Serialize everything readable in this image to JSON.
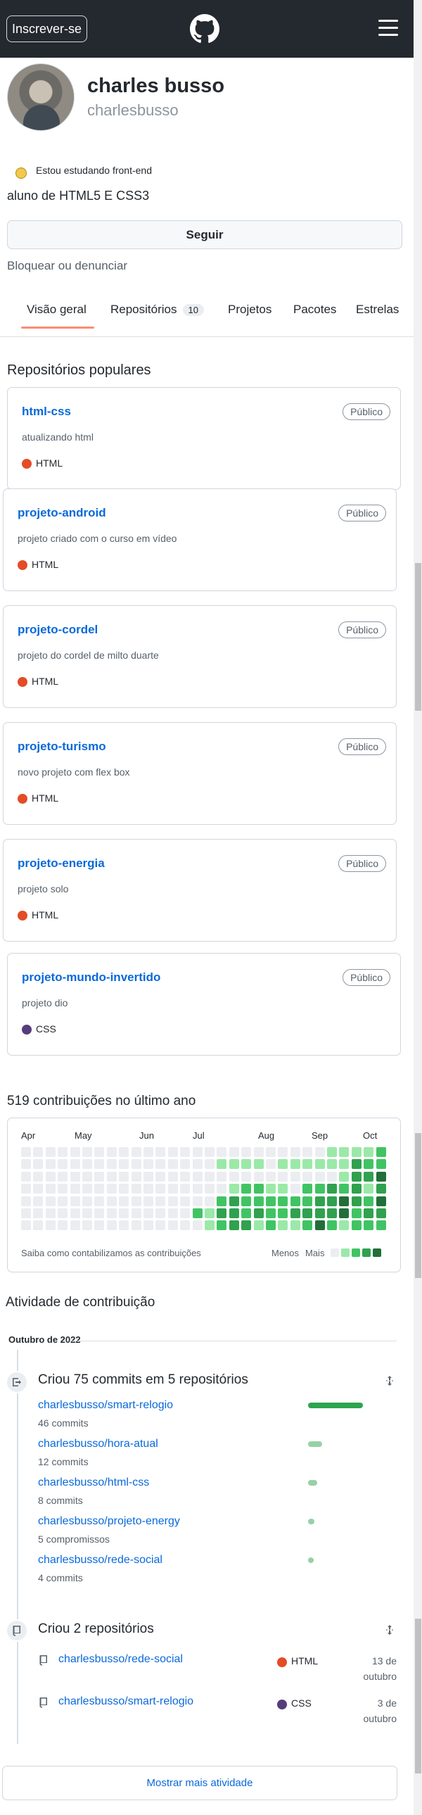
{
  "header": {
    "signup_label": "Inscrever-se",
    "logo_icon": "github-logo-icon",
    "menu_icon": "hamburger-icon"
  },
  "profile": {
    "name": "charles busso",
    "login": "charlesbusso",
    "status_emoji": "emoji-icon",
    "status_text": "Estou estudando front-end",
    "bio": "aluno de HTML5 E CSS3",
    "follow_label": "Seguir",
    "block_label": "Bloquear ou denunciar"
  },
  "tabs": [
    {
      "label": "Visão geral"
    },
    {
      "label": "Repositórios",
      "count": "10"
    },
    {
      "label": "Projetos"
    },
    {
      "label": "Pacotes"
    },
    {
      "label": "Estrelas"
    }
  ],
  "popular": {
    "title": "Repositórios populares",
    "repos": [
      {
        "name": "html-css",
        "visibility": "Público",
        "description": "atualizando html",
        "language": "HTML",
        "color": "#e34c26"
      },
      {
        "name": "projeto-android",
        "visibility": "Público",
        "description": "projeto criado com o curso em vídeo",
        "language": "HTML",
        "color": "#e34c26"
      },
      {
        "name": "projeto-cordel",
        "visibility": "Público",
        "description": "projeto do cordel de milto duarte",
        "language": "HTML",
        "color": "#e34c26"
      },
      {
        "name": "projeto-turismo",
        "visibility": "Público",
        "description": "novo projeto com flex box",
        "language": "HTML",
        "color": "#e34c26"
      },
      {
        "name": "projeto-energia",
        "visibility": "Público",
        "description": "projeto solo",
        "language": "HTML",
        "color": "#e34c26"
      },
      {
        "name": "projeto-mundo-invertido",
        "visibility": "Público",
        "description": "projeto dio",
        "language": "CSS",
        "color": "#563d7c"
      }
    ]
  },
  "contributions": {
    "title": "519 contribuições no último ano",
    "months": [
      "Apr",
      "May",
      "Jun",
      "Jul",
      "Aug",
      "Sep",
      "Oct"
    ],
    "levels": [
      "0000000000000000",
      "0000000000000000",
      "0000000000000000",
      "0000000000000000",
      "0000000000000000",
      "0000000000000000",
      "0000000000000000",
      "0000000000000000",
      "0000000000000000",
      "0000000000000000",
      "0000000000000000",
      "0000000000000000",
      "0000000000000000",
      "0000000000000000",
      "0000020000000000",
      "0000011200000000",
      "0100232000000000",
      "0101333000000000",
      "0102223000000000",
      "0102231000000000",
      "0001222000000000",
      "0101221000000000",
      "0100231000000000",
      "0102232000000000",
      "0102334000000000",
      "1103332000000000",
      "1112441200000000",
      "1333322000000000",
      "1231232000000000",
      "2243432000000000"
    ],
    "colors": [
      "#ebedf0",
      "#9be9a8",
      "#40c463",
      "#30a14e",
      "#216e39"
    ],
    "legend_note": "Saiba como contabilizamos as contribuições",
    "legend_less": "Menos",
    "legend_more": "Mais"
  },
  "activity": {
    "title": "Atividade de contribuição",
    "period": "Outubro de 2022",
    "commits": {
      "title": "Criou 75 commits em 5 repositórios",
      "items": [
        {
          "repo": "charlesbusso/smart-relogio",
          "count": "46 commits",
          "share": 1.0
        },
        {
          "repo": "charlesbusso/hora-atual",
          "count": "12 commits",
          "share": 0.26
        },
        {
          "repo": "charlesbusso/html-css",
          "count": "8 commits",
          "share": 0.17
        },
        {
          "repo": "charlesbusso/projeto-energy",
          "count": "5 compromissos",
          "share": 0.11
        },
        {
          "repo": "charlesbusso/rede-social",
          "count": "4 commits",
          "share": 0.09
        }
      ]
    },
    "created": {
      "title": "Criou 2 repositórios",
      "items": [
        {
          "repo": "charlesbusso/rede-social",
          "language": "HTML",
          "color": "#e34c26",
          "date_day": "13 de",
          "date_month": "outubro"
        },
        {
          "repo": "charlesbusso/smart-relogio",
          "language": "CSS",
          "color": "#563d7c",
          "date_day": "3 de",
          "date_month": "outubro"
        }
      ]
    },
    "more_label": "Mostrar mais atividade"
  }
}
